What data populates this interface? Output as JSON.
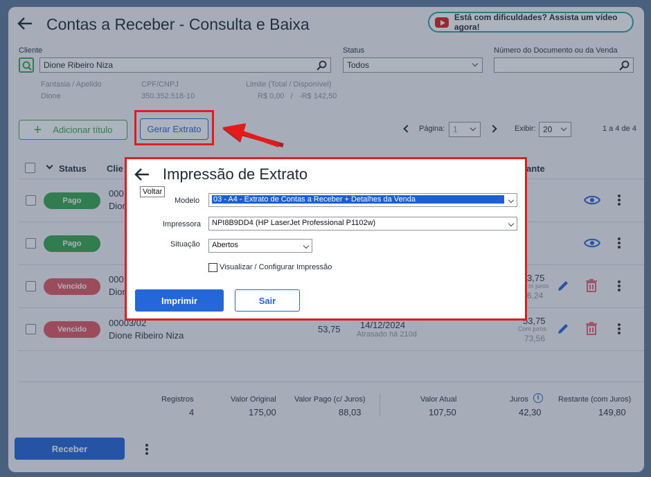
{
  "header": {
    "title": "Contas a Receber - Consulta e Baixa",
    "help": "Está com dificuldades? Assista um vídeo agora!"
  },
  "filters": {
    "cliente_label": "Cliente",
    "cliente_value": "Dione Ribeiro Niza",
    "status_label": "Status",
    "status_value": "Todos",
    "doc_label": "Número do Documento ou da Venda",
    "doc_value": ""
  },
  "client_info": {
    "fantasia_label": "Fantasia / Apelido",
    "fantasia_value": "Dione",
    "cpf_label": "CPF/CNPJ",
    "cpf_value": "350.352.518-10",
    "limite_label": "Limite (Total / Disponível)",
    "limite_value": "R$ 0,00   /   -R$ 142,50"
  },
  "toolbar": {
    "add": "Adicionar título",
    "extrato": "Gerar Extrato",
    "pagina_label": "Página:",
    "pagina_value": "1",
    "exibir_label": "Exibir:",
    "exibir_value": "20",
    "range": "1 a 4 de 4"
  },
  "table": {
    "status_header": "Status",
    "cliente_header": "Clie",
    "restante_header": "ante",
    "rows": [
      {
        "status": "Pago",
        "doc": "000",
        "name": "Dion",
        "restante": "",
        "sub": "",
        "sub2": ""
      },
      {
        "status": "Pago",
        "doc": "",
        "name": "",
        "restante": "",
        "sub": "",
        "sub2": ""
      },
      {
        "status": "Vencido",
        "doc": "000",
        "name": "Dion",
        "restante": "3,75",
        "sub": "m juros",
        "sub2": "6,24"
      },
      {
        "status": "Vencido",
        "doc": "00003/02",
        "name": "Dione Ribeiro Niza",
        "valor": "53,75",
        "date": "14/12/2024",
        "late": "Atrasado há 210d",
        "restante": "53,75",
        "sub": "Com juros",
        "sub2": "73,56"
      }
    ]
  },
  "summary": {
    "registros_label": "Registros",
    "registros_value": "4",
    "vo_label": "Valor Original",
    "vo_value": "175,00",
    "vp_label": "Valor Pago (c/ Juros)",
    "vp_value": "88,03",
    "va_label": "Valor Atual",
    "va_value": "107,50",
    "juros_label": "Juros",
    "juros_value": "42,30",
    "rest_label": "Restante (com Juros)",
    "rest_value": "149,80"
  },
  "footer": {
    "receber": "Receber"
  },
  "dialog": {
    "title": "Impressão de Extrato",
    "tooltip": "Voltar",
    "modelo_label": "Modelo",
    "modelo_value": "03 - A4 - Extrato de Contas a Receber + Detalhes da Venda",
    "impressora_label": "Impressora",
    "impressora_value": "NPI8B9DD4 (HP LaserJet Professional P1102w)",
    "situacao_label": "Situação",
    "situacao_value": "Abertos",
    "visualizar": "Visualizar / Configurar Impressão",
    "imprimir": "Imprimir",
    "sair": "Sair"
  },
  "colors": {
    "accent": "#2566d8",
    "green": "#39a852",
    "red": "#e51a1a"
  }
}
